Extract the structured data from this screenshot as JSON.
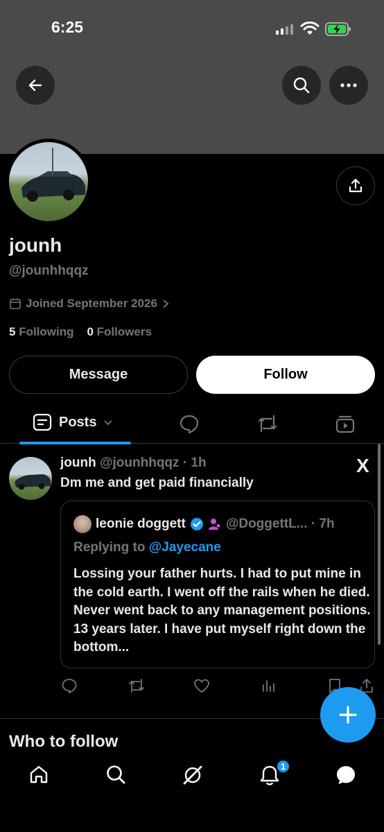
{
  "status_bar": {
    "time": "6:25"
  },
  "profile": {
    "name": "jounh",
    "handle": "@jounhhqqz",
    "joined": "Joined September 2026",
    "following_count": "5",
    "following_label": "Following",
    "followers_count": "0",
    "followers_label": "Followers",
    "message_label": "Message",
    "follow_label": "Follow"
  },
  "tabs": {
    "posts_label": "Posts"
  },
  "post": {
    "author_name": "jounh",
    "author_handle_time": "@jounhhqqz · 1h",
    "text": "Dm me and get paid financially",
    "badge_x": "X",
    "quote": {
      "author_name": "leonie doggett",
      "author_handle_time": "@DoggettL... · 7h",
      "replying_prefix": "Replying to",
      "replying_to": "@Jayecane",
      "text": "Lossing your father hurts. I had to put mine in the cold earth. I went off the rails when he died. Never went back to any management positions. 13 years later. I have put myself right down the bottom..."
    }
  },
  "who_to_follow": "Who to follow",
  "notifications_badge": "1",
  "colors": {
    "accent": "#1d9bf0",
    "banner": "#4a4a4a",
    "muted": "#71767b"
  },
  "icons": [
    "back-arrow-icon",
    "search-icon",
    "more-icon",
    "share-icon",
    "calendar-icon",
    "chevron-right-icon",
    "posts-icon",
    "chevron-down-icon",
    "replies-icon",
    "reposts-icon",
    "media-icon",
    "verified-icon",
    "affiliate-icon",
    "reply-icon",
    "repost-icon",
    "like-icon",
    "views-icon",
    "bookmark-icon",
    "plus-icon",
    "home-icon",
    "grok-icon",
    "bell-icon",
    "messages-icon"
  ]
}
